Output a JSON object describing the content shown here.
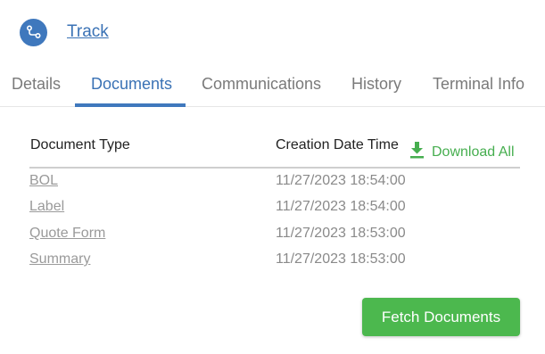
{
  "header": {
    "track_label": "Track"
  },
  "tabs": [
    {
      "label": "Details"
    },
    {
      "label": "Documents"
    },
    {
      "label": "Communications"
    },
    {
      "label": "History"
    },
    {
      "label": "Terminal Info"
    }
  ],
  "active_tab": "Documents",
  "table": {
    "columns": [
      "Document Type",
      "Creation Date Time"
    ],
    "download_all_label": "Download All",
    "rows": [
      {
        "document_type": "BOL",
        "created": "11/27/2023 18:54:00"
      },
      {
        "document_type": "Label",
        "created": "11/27/2023 18:54:00"
      },
      {
        "document_type": "Quote Form",
        "created": "11/27/2023 18:53:00"
      },
      {
        "document_type": "Summary",
        "created": "11/27/2023 18:53:00"
      }
    ]
  },
  "actions": {
    "fetch_documents_label": "Fetch Documents"
  },
  "icons": {
    "track": "route-icon",
    "download": "download-icon"
  },
  "colors": {
    "accent_blue": "#3f78bd",
    "action_green": "#4cb84e",
    "link_green": "#46ae4f"
  }
}
